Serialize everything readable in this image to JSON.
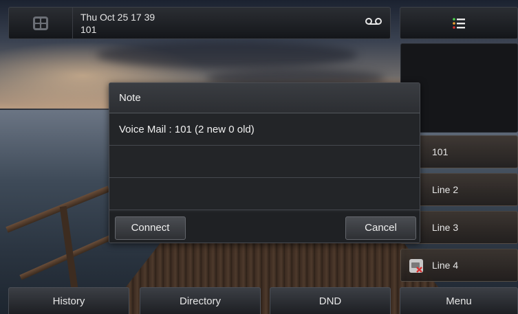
{
  "topbar": {
    "date_time": "Thu Oct 25 17 39",
    "account": "101",
    "apps_icon": "grid-icon",
    "voicemail_icon": "voicemail-icon",
    "menu_icon": "list-menu-icon"
  },
  "line_keys": [
    {
      "label": "101",
      "icon": "line-indicator"
    },
    {
      "label": "Line 2",
      "icon": "line-indicator"
    },
    {
      "label": "Line 3",
      "icon": "line-indicator"
    },
    {
      "label": "Line 4",
      "icon": "unregistered-icon"
    }
  ],
  "softkeys": [
    "History",
    "Directory",
    "DND",
    "Menu"
  ],
  "dialog": {
    "title": "Note",
    "message": "Voice Mail : 101 (2 new 0 old)",
    "connect_label": "Connect",
    "cancel_label": "Cancel"
  },
  "colors": {
    "menu_icon_green": "#4cd44c",
    "menu_icon_orange": "#f0a030",
    "alert_red": "#d83030"
  }
}
